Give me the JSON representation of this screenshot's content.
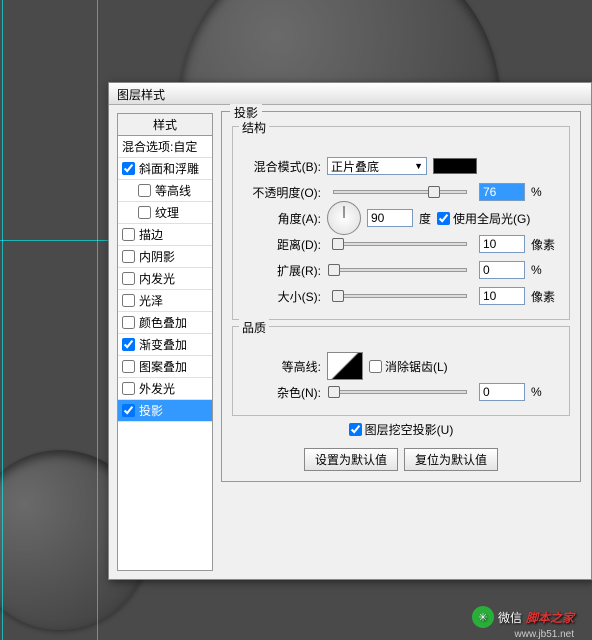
{
  "dialog": {
    "title": "图层样式"
  },
  "sidebar": {
    "header": "样式",
    "items": [
      {
        "label": "混合选项:自定",
        "cb": false,
        "indent": false,
        "checked": false,
        "sel": false
      },
      {
        "label": "斜面和浮雕",
        "cb": true,
        "indent": false,
        "checked": true,
        "sel": false
      },
      {
        "label": "等高线",
        "cb": true,
        "indent": true,
        "checked": false,
        "sel": false
      },
      {
        "label": "纹理",
        "cb": true,
        "indent": true,
        "checked": false,
        "sel": false
      },
      {
        "label": "描边",
        "cb": true,
        "indent": false,
        "checked": false,
        "sel": false
      },
      {
        "label": "内阴影",
        "cb": true,
        "indent": false,
        "checked": false,
        "sel": false
      },
      {
        "label": "内发光",
        "cb": true,
        "indent": false,
        "checked": false,
        "sel": false
      },
      {
        "label": "光泽",
        "cb": true,
        "indent": false,
        "checked": false,
        "sel": false
      },
      {
        "label": "颜色叠加",
        "cb": true,
        "indent": false,
        "checked": false,
        "sel": false
      },
      {
        "label": "渐变叠加",
        "cb": true,
        "indent": false,
        "checked": true,
        "sel": false
      },
      {
        "label": "图案叠加",
        "cb": true,
        "indent": false,
        "checked": false,
        "sel": false
      },
      {
        "label": "外发光",
        "cb": true,
        "indent": false,
        "checked": false,
        "sel": false
      },
      {
        "label": "投影",
        "cb": true,
        "indent": false,
        "checked": true,
        "sel": true
      }
    ]
  },
  "panel": {
    "title": "投影",
    "structure": "结构",
    "quality": "品质",
    "blend_label": "混合模式(B):",
    "blend_value": "正片叠底",
    "opacity_label": "不透明度(O):",
    "opacity_value": "76",
    "angle_label": "角度(A):",
    "angle_value": "90",
    "degree": "度",
    "global_light": "使用全局光(G)",
    "distance_label": "距离(D):",
    "distance_value": "10",
    "spread_label": "扩展(R):",
    "spread_value": "0",
    "size_label": "大小(S):",
    "size_value": "10",
    "contour_label": "等高线:",
    "antialias": "消除锯齿(L)",
    "noise_label": "杂色(N):",
    "noise_value": "0",
    "knockout": "图层挖空投影(U)",
    "make_default": "设置为默认值",
    "reset_default": "复位为默认值",
    "percent": "%",
    "px": "像素"
  },
  "watermark": {
    "prefix": "微信",
    "brand": "脚本之家",
    "url": "www.jb51.net"
  }
}
